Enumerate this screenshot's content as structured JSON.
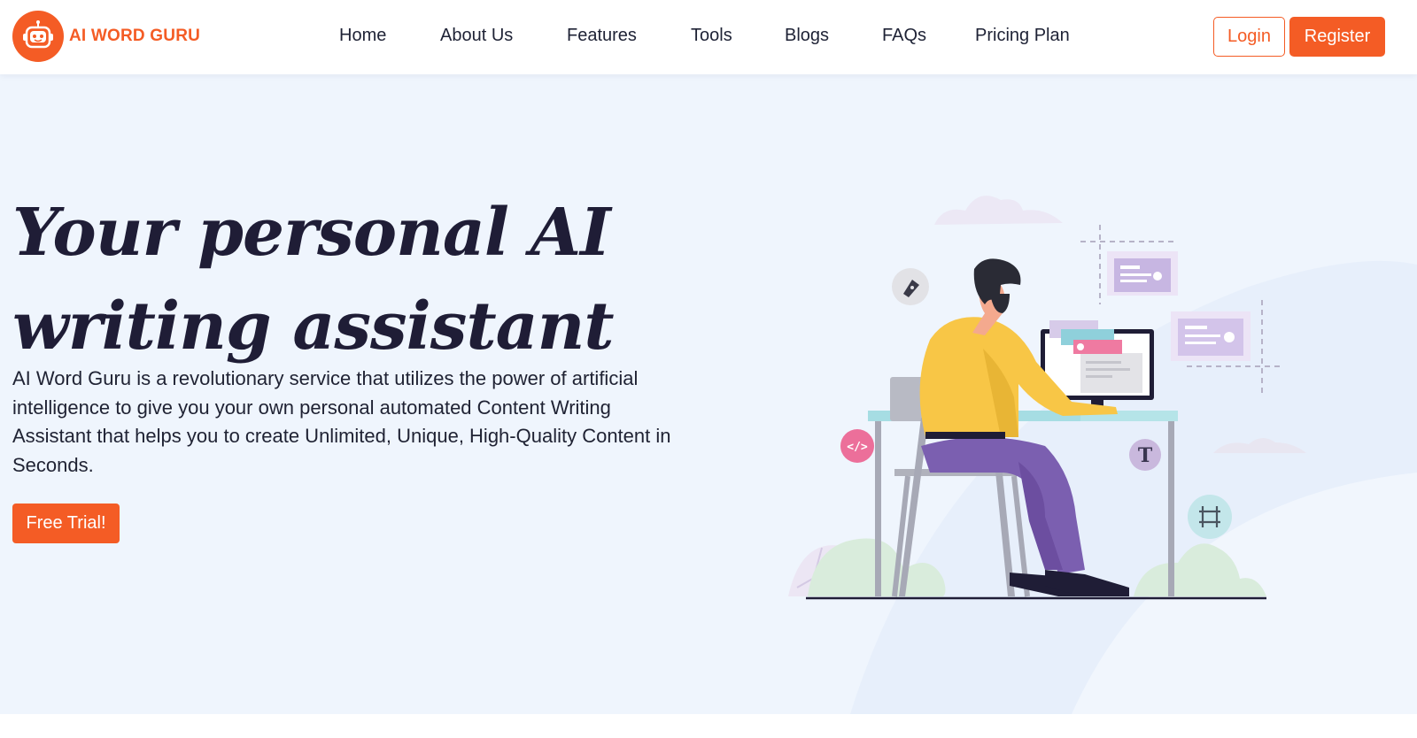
{
  "brand": {
    "name": "AI WORD GURU",
    "primary_color": "#f45c25",
    "text_color": "#1f1d36",
    "hero_bg": "#eff5fd",
    "logo_icon": "robot-icon"
  },
  "nav": {
    "items": [
      {
        "label": "Home"
      },
      {
        "label": "About Us"
      },
      {
        "label": "Features"
      },
      {
        "label": "Tools"
      },
      {
        "label": "Blogs"
      },
      {
        "label": "FAQs"
      },
      {
        "label": "Pricing Plan"
      }
    ],
    "login_label": "Login",
    "register_label": "Register"
  },
  "hero": {
    "title_line1": "Your personal AI",
    "title_line2": "writing assistant",
    "description": "AI Word Guru is a revolutionary service that utilizes the power of artificial intelligence to give you your own personal automated Content Writing Assistant that helps you to create Unlimited, Unique, High-Quality Content in Seconds.",
    "cta_label": "Free Trial!",
    "illustration_icons": [
      "pen-tool-icon",
      "code-icon",
      "text-icon",
      "grid-icon"
    ],
    "text_icon_glyph": "T",
    "code_icon_glyph": "</>"
  }
}
